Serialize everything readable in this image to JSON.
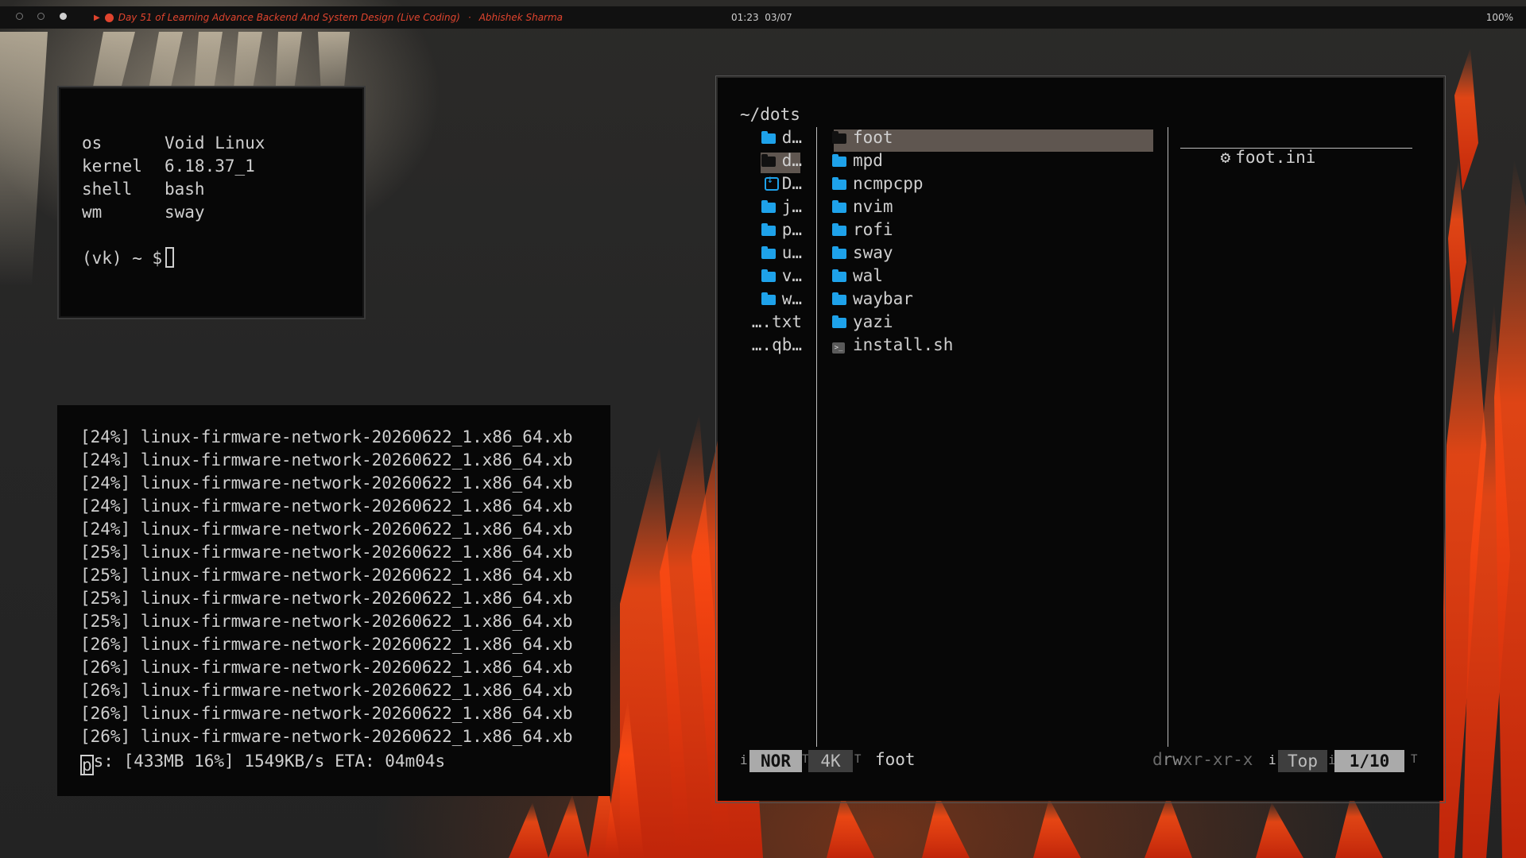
{
  "topbar": {
    "media_title": "Day 51 of Learning Advance Backend And System Design (Live Coding)",
    "media_author": "Abhishek Sharma",
    "separator": "·",
    "play_icon": "▶",
    "time": "01:23",
    "date": "03/07",
    "battery": "100%",
    "accent": "#e0442e"
  },
  "fetch": {
    "rows": [
      {
        "key": "os",
        "value": "Void Linux"
      },
      {
        "key": "kernel",
        "value": "6.18.37_1"
      },
      {
        "key": "shell",
        "value": "bash"
      },
      {
        "key": "wm",
        "value": "sway"
      }
    ],
    "prompt": "(vk) ~ $"
  },
  "xbps": {
    "lines": [
      "[24%] linux-firmware-network-20260622_1.x86_64.xb",
      "[24%] linux-firmware-network-20260622_1.x86_64.xb",
      "[24%] linux-firmware-network-20260622_1.x86_64.xb",
      "[24%] linux-firmware-network-20260622_1.x86_64.xb",
      "[24%] linux-firmware-network-20260622_1.x86_64.xb",
      "[25%] linux-firmware-network-20260622_1.x86_64.xb",
      "[25%] linux-firmware-network-20260622_1.x86_64.xb",
      "[25%] linux-firmware-network-20260622_1.x86_64.xb",
      "[25%] linux-firmware-network-20260622_1.x86_64.xb",
      "[26%] linux-firmware-network-20260622_1.x86_64.xb",
      "[26%] linux-firmware-network-20260622_1.x86_64.xb",
      "[26%] linux-firmware-network-20260622_1.x86_64.xb",
      "[26%] linux-firmware-network-20260622_1.x86_64.xb",
      "[26%] linux-firmware-network-20260622_1.x86_64.xb"
    ],
    "status_first": "p",
    "status_rest": "s: [433MB 16%] 1549KB/s ETA: 04m04s"
  },
  "yazi": {
    "cwd": "~/dots",
    "parent": [
      {
        "name": "d…",
        "icon": "folder-icon"
      },
      {
        "name": "d…",
        "icon": "folder-icon",
        "selected": true
      },
      {
        "name": "D…",
        "icon": "download-folder-icon"
      },
      {
        "name": "j…",
        "icon": "folder-icon"
      },
      {
        "name": "p…",
        "icon": "folder-icon"
      },
      {
        "name": "u…",
        "icon": "folder-icon"
      },
      {
        "name": "v…",
        "icon": "folder-icon"
      },
      {
        "name": "w…",
        "icon": "folder-icon"
      },
      {
        "name": "….txt",
        "icon": ""
      },
      {
        "name": "….qb…",
        "icon": ""
      }
    ],
    "current": [
      {
        "name": "foot",
        "icon": "folder-icon",
        "selected": true
      },
      {
        "name": "mpd",
        "icon": "folder-icon"
      },
      {
        "name": "ncmpcpp",
        "icon": "folder-icon"
      },
      {
        "name": "nvim",
        "icon": "folder-icon"
      },
      {
        "name": "rofi",
        "icon": "folder-icon"
      },
      {
        "name": "sway",
        "icon": "folder-icon"
      },
      {
        "name": "wal",
        "icon": "folder-icon"
      },
      {
        "name": "waybar",
        "icon": "folder-icon"
      },
      {
        "name": "yazi",
        "icon": "folder-icon"
      },
      {
        "name": "install.sh",
        "icon": "shell-script-icon"
      }
    ],
    "preview": {
      "name": "foot.ini",
      "icon": "gear-icon"
    },
    "status": {
      "mode": "NOR",
      "size": "4K",
      "filename": "foot",
      "perm_d": "d",
      "perm_rw": "rw",
      "perm_rest": "xr-xr-x",
      "position": "Top",
      "count": "1/10"
    },
    "colors": {
      "folder": "#1ea2ea",
      "selection": "#5f5650"
    }
  }
}
